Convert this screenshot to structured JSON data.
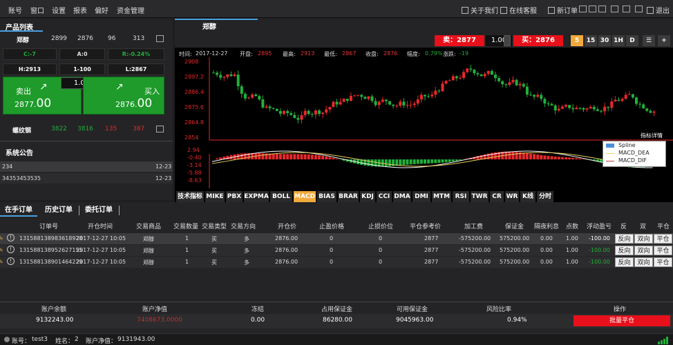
{
  "menubar": {
    "items": [
      "账号",
      "窗口",
      "设置",
      "报表",
      "偏好",
      "资金管理"
    ],
    "tools": [
      "关于我们",
      "在线客服",
      "新订单"
    ],
    "exit": "退出"
  },
  "left": {
    "product_tab": "产品列表",
    "products": [
      {
        "name": "郑醇",
        "v1": "2899",
        "v2": "2876",
        "v3": "96",
        "v4": "313"
      },
      {
        "name": "螺纹钢",
        "v1": "3822",
        "v2": "3816",
        "v3": "135",
        "v4": "387"
      }
    ],
    "c_label": "C:-7",
    "a_label": "A:0",
    "r_label": "R:-0.24%",
    "h_label": "H:2913",
    "range_label": "1-100",
    "l_label": "L:2867",
    "sell_label": "卖出",
    "buy_label": "买入",
    "sell_price_int": "2877.",
    "sell_price_dec": "00",
    "buy_price_int": "2876.",
    "buy_price_dec": "00",
    "qty": "1.00",
    "notice_title": "系统公告",
    "notices": [
      {
        "text": "234",
        "date": "12-23"
      },
      {
        "text": "34353453535",
        "date": "12-23"
      }
    ]
  },
  "chart": {
    "title": "郑醇",
    "sell_btn": "卖：2877",
    "qty": "1.00",
    "buy_btn": "买：2876",
    "timeframes": [
      "5",
      "15",
      "30",
      "1H",
      "D"
    ],
    "info": {
      "time_label": "时间:",
      "time": "2017-12-27",
      "open_label": "开盘:",
      "open": "2895",
      "high_label": "最高:",
      "high": "2913",
      "low_label": "最低:",
      "low": "2867",
      "close_label": "收盘:",
      "close": "2876",
      "amp_label": "幅度:",
      "amp": "0.79%",
      "chg_label": "涨跌:",
      "chg": "-19"
    },
    "price_ticks": [
      "2908",
      "2897.2",
      "2886.4",
      "2875.6",
      "2864.8",
      "2854"
    ],
    "macd_ticks": [
      "2.94",
      "-0.40",
      "-3.14",
      "-5.88",
      "-8.63"
    ],
    "legend_title": "指标详情",
    "legend": [
      "Spline",
      "MACD_DEA",
      "MACD_DIF"
    ],
    "indicators": [
      "技术指标",
      "MIKE",
      "PBX",
      "EXPMA",
      "BOLL",
      "MACD",
      "BIAS",
      "BRAR",
      "KDJ",
      "CCI",
      "DMA",
      "DMI",
      "MTM",
      "RSI",
      "TWR",
      "CR",
      "WR",
      "K线",
      "分时"
    ]
  },
  "orders": {
    "tabs": [
      "在手订单",
      "历史订单",
      "委托订单"
    ],
    "headers": [
      "订单号",
      "开仓时间",
      "交易商品",
      "交易数量",
      "交易类型",
      "交易方向",
      "开仓价",
      "止盈价格",
      "止损价位",
      "平仓参考价",
      "加工费",
      "保证金",
      "隔夜利息",
      "点数",
      "浮动盈亏",
      "反",
      "双",
      "平仓"
    ],
    "rows": [
      {
        "id": "131588138983618928",
        "time": "2017-12-27 10:05",
        "product": "郑醇",
        "qty": "1",
        "type": "买",
        "dir": "多",
        "open": "2876.00",
        "tp": "0",
        "sl": "0",
        "ref": "2877",
        "fee": "-575200.00",
        "margin": "575200.00",
        "interest": "0.00",
        "points": "1.00",
        "pl": "-100.00"
      },
      {
        "id": "131588138952627155",
        "time": "2017-12-27 10:05",
        "product": "郑醇",
        "qty": "1",
        "type": "买",
        "dir": "多",
        "open": "2876.00",
        "tp": "0",
        "sl": "0",
        "ref": "2877",
        "fee": "-575200.00",
        "margin": "575200.00",
        "interest": "0.00",
        "points": "1.00",
        "pl": "-100.00"
      },
      {
        "id": "131588138901464229",
        "time": "2017-12-27 10:05",
        "product": "郑醇",
        "qty": "1",
        "type": "买",
        "dir": "多",
        "open": "2876.00",
        "tp": "0",
        "sl": "0",
        "ref": "2877",
        "fee": "-575200.00",
        "margin": "575200.00",
        "interest": "0.00",
        "points": "1.00",
        "pl": "-100.00"
      }
    ],
    "btn_reverse": "反向",
    "btn_double": "双向",
    "btn_close": "平仓"
  },
  "summary": {
    "labels": [
      "账户余额",
      "账户净值",
      "冻结",
      "占用保证金",
      "可用保证金",
      "风险比率",
      "操作"
    ],
    "values": [
      "9132243.00",
      "7408673.0000",
      "0.00",
      "86280.00",
      "9045963.00",
      "0.94%"
    ],
    "batch_close": "批量平仓"
  },
  "status": {
    "account_label": "账号：",
    "account": "test3",
    "name_label": "姓名：",
    "name": "2",
    "equity_label": "账户净值：",
    "equity": "9131943.00"
  },
  "colors": {
    "up": "#e8282b",
    "down": "#22b03a",
    "accent": "#f2a93b",
    "panel_green": "#1e9b2a"
  }
}
